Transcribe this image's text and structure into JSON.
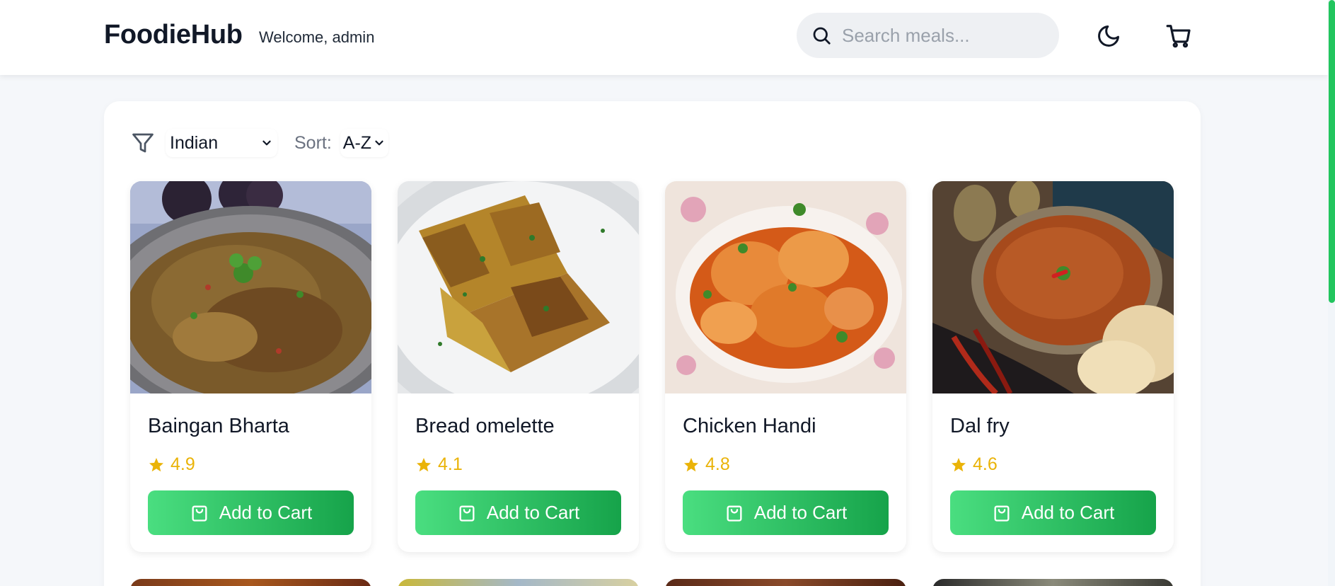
{
  "header": {
    "brand": "FoodieHub",
    "welcome": "Welcome, admin",
    "search_placeholder": "Search meals...",
    "icons": [
      "search-icon",
      "moon-icon",
      "cart-icon"
    ]
  },
  "filters": {
    "cuisine": "Indian",
    "sort_label": "Sort:",
    "sort_value": "A-Z"
  },
  "colors": {
    "accent_start": "#4ade80",
    "accent_end": "#16a34a",
    "star": "#eab308"
  },
  "meals": [
    {
      "name": "Baingan Bharta",
      "rating": "4.9",
      "button": "Add to Cart"
    },
    {
      "name": "Bread omelette",
      "rating": "4.1",
      "button": "Add to Cart"
    },
    {
      "name": "Chicken Handi",
      "rating": "4.8",
      "button": "Add to Cart"
    },
    {
      "name": "Dal fry",
      "rating": "4.6",
      "button": "Add to Cart"
    }
  ]
}
